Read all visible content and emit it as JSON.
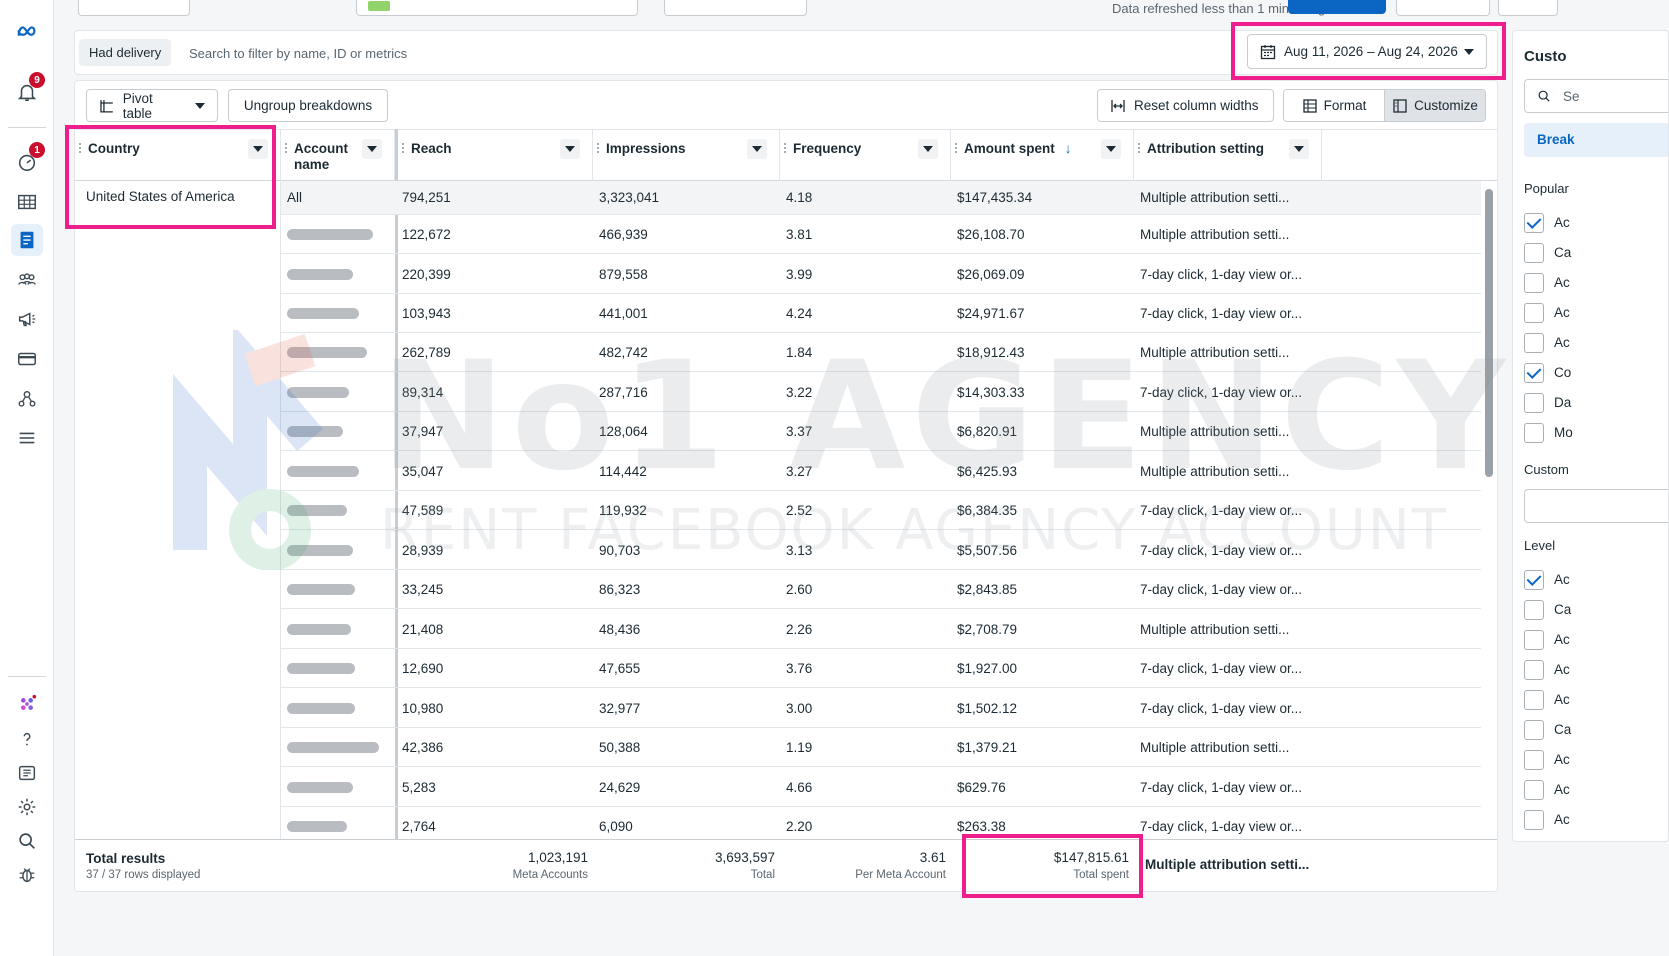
{
  "top": {
    "refresh_text": "Data refreshed less than 1 minute ago"
  },
  "nav": {
    "notifications_badge": "9",
    "help_badge": "1"
  },
  "filter": {
    "chip_label": "Had delivery",
    "search_placeholder": "Search to filter by name, ID or metrics",
    "date_range": "Aug 11, 2026 – Aug 24, 2026"
  },
  "toolbar": {
    "pivot_label": "Pivot table",
    "ungroup_label": "Ungroup breakdowns",
    "reset_label": "Reset column widths",
    "format_label": "Format",
    "customize_label": "Customize"
  },
  "table": {
    "columns": [
      "Country",
      "Account name",
      "Reach",
      "Impressions",
      "Frequency",
      "Amount spent",
      "Attribution setting"
    ],
    "country": "United States of America",
    "rows": [
      {
        "account": "All",
        "reach": "794,251",
        "impressions": "3,323,041",
        "frequency": "4.18",
        "spent": "$147,435.34",
        "attribution": "Multiple attribution setti..."
      },
      {
        "account": "",
        "reach": "122,672",
        "impressions": "466,939",
        "frequency": "3.81",
        "spent": "$26,108.70",
        "attribution": "Multiple attribution setti..."
      },
      {
        "account": "",
        "reach": "220,399",
        "impressions": "879,558",
        "frequency": "3.99",
        "spent": "$26,069.09",
        "attribution": "7-day click, 1-day view or..."
      },
      {
        "account": "",
        "reach": "103,943",
        "impressions": "441,001",
        "frequency": "4.24",
        "spent": "$24,971.67",
        "attribution": "7-day click, 1-day view or..."
      },
      {
        "account": "",
        "reach": "262,789",
        "impressions": "482,742",
        "frequency": "1.84",
        "spent": "$18,912.43",
        "attribution": "Multiple attribution setti..."
      },
      {
        "account": "",
        "reach": "89,314",
        "impressions": "287,716",
        "frequency": "3.22",
        "spent": "$14,303.33",
        "attribution": "7-day click, 1-day view or..."
      },
      {
        "account": "",
        "reach": "37,947",
        "impressions": "128,064",
        "frequency": "3.37",
        "spent": "$6,820.91",
        "attribution": "Multiple attribution setti..."
      },
      {
        "account": "",
        "reach": "35,047",
        "impressions": "114,442",
        "frequency": "3.27",
        "spent": "$6,425.93",
        "attribution": "Multiple attribution setti..."
      },
      {
        "account": "",
        "reach": "47,589",
        "impressions": "119,932",
        "frequency": "2.52",
        "spent": "$6,384.35",
        "attribution": "7-day click, 1-day view or..."
      },
      {
        "account": "",
        "reach": "28,939",
        "impressions": "90,703",
        "frequency": "3.13",
        "spent": "$5,507.56",
        "attribution": "7-day click, 1-day view or..."
      },
      {
        "account": "",
        "reach": "33,245",
        "impressions": "86,323",
        "frequency": "2.60",
        "spent": "$2,843.85",
        "attribution": "7-day click, 1-day view or..."
      },
      {
        "account": "",
        "reach": "21,408",
        "impressions": "48,436",
        "frequency": "2.26",
        "spent": "$2,708.79",
        "attribution": "Multiple attribution setti..."
      },
      {
        "account": "",
        "reach": "12,690",
        "impressions": "47,655",
        "frequency": "3.76",
        "spent": "$1,927.00",
        "attribution": "7-day click, 1-day view or..."
      },
      {
        "account": "",
        "reach": "10,980",
        "impressions": "32,977",
        "frequency": "3.00",
        "spent": "$1,502.12",
        "attribution": "7-day click, 1-day view or..."
      },
      {
        "account": "",
        "reach": "42,386",
        "impressions": "50,388",
        "frequency": "1.19",
        "spent": "$1,379.21",
        "attribution": "Multiple attribution setti..."
      },
      {
        "account": "",
        "reach": "5,283",
        "impressions": "24,629",
        "frequency": "4.66",
        "spent": "$629.76",
        "attribution": "7-day click, 1-day view or..."
      },
      {
        "account": "",
        "reach": "2,764",
        "impressions": "6,090",
        "frequency": "2.20",
        "spent": "$263.38",
        "attribution": "7-day click, 1-day view or..."
      }
    ],
    "totals": {
      "title": "Total results",
      "rows_displayed": "37 / 37 rows displayed",
      "reach": "1,023,191",
      "reach_label": "Meta Accounts",
      "impressions": "3,693,597",
      "impressions_label": "Total",
      "frequency": "3.61",
      "frequency_label": "Per Meta Account",
      "spent": "$147,815.61",
      "spent_label": "Total spent",
      "attribution": "Multiple attribution setti..."
    }
  },
  "right_panel": {
    "title": "Custo",
    "search_text": "Se",
    "tab": "Break",
    "popular_label": "Popular",
    "popular_items": [
      {
        "label": "Ac",
        "checked": true
      },
      {
        "label": "Ca",
        "checked": false
      },
      {
        "label": "Ac",
        "checked": false
      },
      {
        "label": "Ac",
        "checked": false
      },
      {
        "label": "Ac",
        "checked": false
      },
      {
        "label": "Co",
        "checked": true
      },
      {
        "label": "Da",
        "checked": false
      },
      {
        "label": "Mo",
        "checked": false
      }
    ],
    "custom_label": "Custom",
    "level_label": "Level",
    "level_items": [
      {
        "label": "Ac",
        "checked": true
      },
      {
        "label": "Ca",
        "checked": false
      },
      {
        "label": "Ac",
        "checked": false
      },
      {
        "label": "Ac",
        "checked": false
      },
      {
        "label": "Ac",
        "checked": false
      },
      {
        "label": "Ca",
        "checked": false
      },
      {
        "label": "Ac",
        "checked": false
      },
      {
        "label": "Ac",
        "checked": false
      },
      {
        "label": "Ac",
        "checked": false
      }
    ]
  },
  "watermark": {
    "big": "No1 AGENCY",
    "small": "RENT FACEBOOK AGENCY ACCOUNT"
  }
}
